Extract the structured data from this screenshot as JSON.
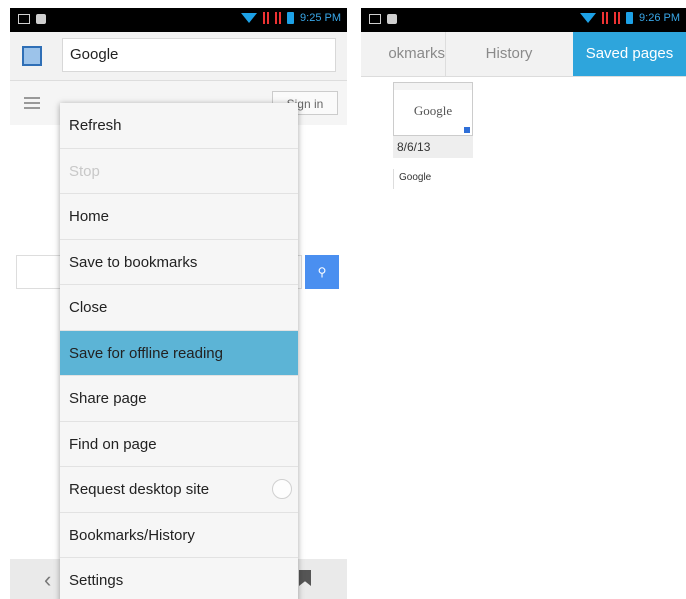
{
  "left_screen": {
    "status": {
      "time": "9:25 PM"
    },
    "url": "Google",
    "signin": "Sign in",
    "menu": [
      {
        "label": "Refresh",
        "state": "normal"
      },
      {
        "label": "Stop",
        "state": "disabled"
      },
      {
        "label": "Home",
        "state": "normal"
      },
      {
        "label": "Save to bookmarks",
        "state": "normal"
      },
      {
        "label": "Close",
        "state": "normal"
      },
      {
        "label": "Save for offline reading",
        "state": "selected"
      },
      {
        "label": "Share page",
        "state": "normal"
      },
      {
        "label": "Find on page",
        "state": "normal"
      },
      {
        "label": "Request desktop site",
        "state": "normal"
      },
      {
        "label": "Bookmarks/History",
        "state": "normal"
      },
      {
        "label": "Settings",
        "state": "normal"
      }
    ],
    "icons": {
      "site": "site-icon",
      "menu": "hamburger-icon",
      "search": "search-icon",
      "back": "back-icon",
      "bookmark": "bookmark-icon"
    }
  },
  "right_screen": {
    "status": {
      "time": "9:26 PM"
    },
    "tabs": {
      "bookmarks": "okmarks",
      "history": "History",
      "saved": "Saved pages"
    },
    "saved_item": {
      "thumbnail_logo": "Google",
      "date": "8/6/13",
      "title": "Google"
    }
  },
  "colors": {
    "accent": "#2ea5dc",
    "selected_menu": "#5cb4d6",
    "search_button": "#4a8ff0"
  }
}
